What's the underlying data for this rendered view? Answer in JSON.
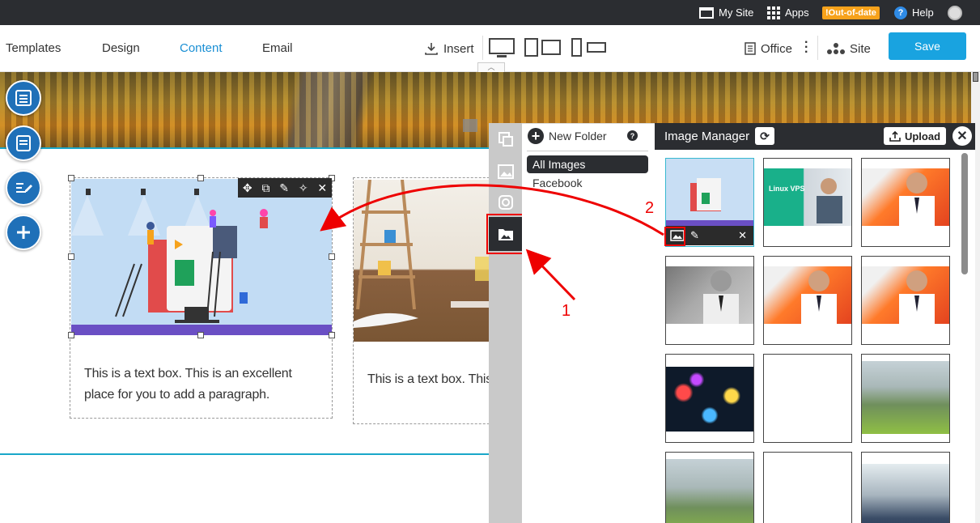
{
  "topbar": {
    "my_site": "My Site",
    "apps": "Apps",
    "badge": "!Out-of-date",
    "help": "Help"
  },
  "nav": {
    "tabs": [
      {
        "label": "Templates",
        "active": false
      },
      {
        "label": "Design",
        "active": false
      },
      {
        "label": "Content",
        "active": true
      },
      {
        "label": "Email",
        "active": false
      }
    ],
    "insert": "Insert",
    "office": "Office",
    "site": "Site",
    "save": "Save"
  },
  "cards": [
    {
      "text": "This is a text box. This is an excellent place for you to add a paragraph."
    },
    {
      "text": "This is a text box. This is an excellent place for you to add a paragraph."
    }
  ],
  "folder_panel": {
    "new_folder": "New Folder",
    "help": "?",
    "folders": [
      {
        "label": "All Images",
        "active": true
      },
      {
        "label": "Facebook",
        "active": false
      }
    ]
  },
  "image_manager": {
    "title": "Image Manager",
    "upload": "Upload",
    "thumbs": [
      {
        "kind": "illustration"
      },
      {
        "kind": "vps-banner",
        "caption": "Linux VPS"
      },
      {
        "kind": "man-orange"
      },
      {
        "kind": "man-gray"
      },
      {
        "kind": "man-orange"
      },
      {
        "kind": "man-orange"
      },
      {
        "kind": "lights"
      },
      {
        "kind": "blank"
      },
      {
        "kind": "mountain"
      },
      {
        "kind": "mountain"
      },
      {
        "kind": "blank"
      },
      {
        "kind": "building"
      }
    ]
  },
  "annotations": {
    "step1": "1",
    "step2": "2",
    "arrow_color": "#ee0000"
  },
  "colors": {
    "accent": "#19a3e0",
    "dark": "#2b2d31",
    "tool_circle": "#1f70b8"
  }
}
